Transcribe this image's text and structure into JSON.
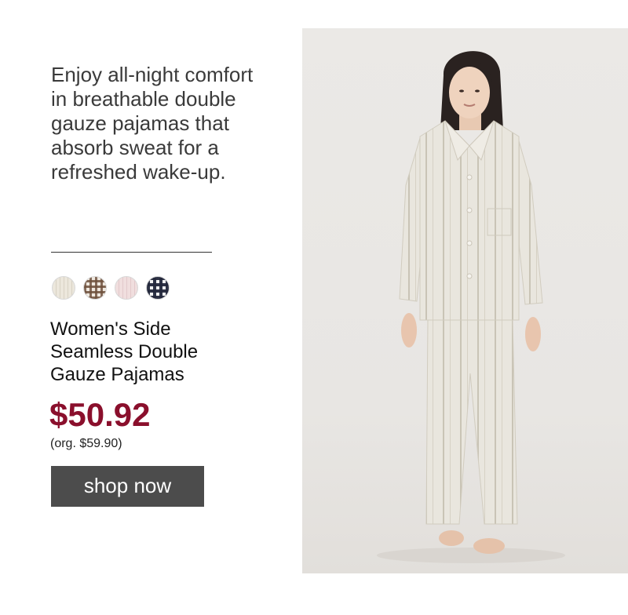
{
  "promo": {
    "description": "Enjoy all-night comfort in breathable double gauze pajamas that absorb sweat for a refreshed wake-up."
  },
  "swatches": [
    {
      "name": "ivory-stripe-swatch",
      "color": "#e6e0d4"
    },
    {
      "name": "brown-check-swatch",
      "color": "#7a5a44"
    },
    {
      "name": "pink-stripe-swatch",
      "color": "#ecd6d7"
    },
    {
      "name": "navy-check-swatch",
      "color": "#232838"
    }
  ],
  "product": {
    "name": "Women's Side Seamless Double Gauze Pajamas",
    "sale_price": "$50.92",
    "original_price": "(org. $59.90)"
  },
  "cta": {
    "label": "shop now"
  },
  "colors": {
    "price": "#8a0f2c",
    "button_bg": "#4c4c4c",
    "photo_bg": "#ebe9e6"
  }
}
